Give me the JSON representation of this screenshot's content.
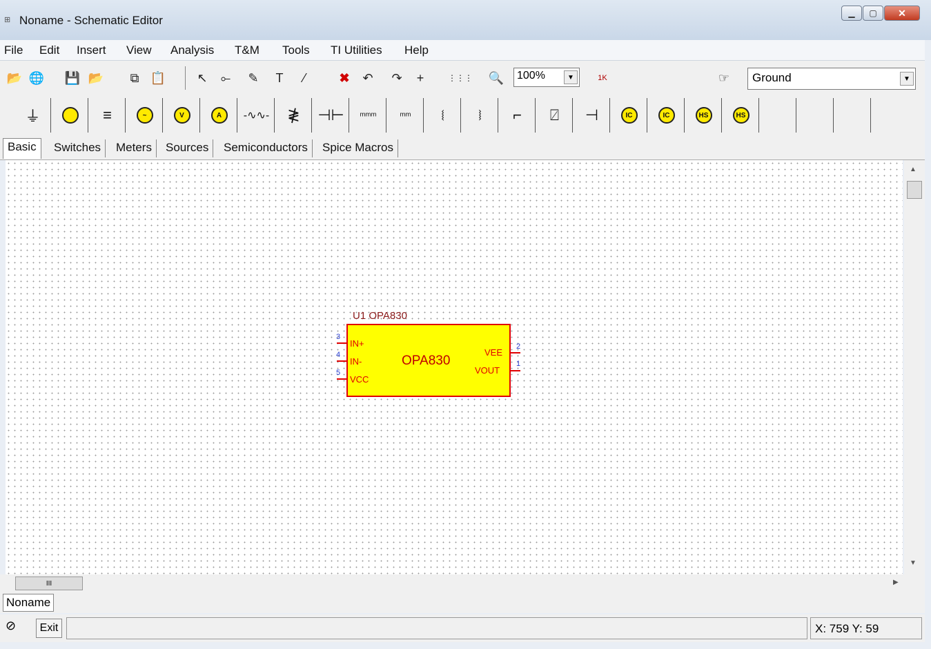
{
  "window": {
    "title": "Noname - Schematic Editor"
  },
  "menu": [
    "File",
    "Edit",
    "Insert",
    "View",
    "Analysis",
    "T&M",
    "Tools",
    "TI Utilities",
    "Help"
  ],
  "toolbar": {
    "zoom": "100%",
    "component_select": "Ground",
    "zoom_k_label": "1K"
  },
  "tabs": [
    "Basic",
    "Switches",
    "Meters",
    "Sources",
    "Semiconductors",
    "Spice Macros"
  ],
  "component": {
    "ref_label": "U1 OPA830",
    "center_label": "OPA830",
    "pins_left": [
      {
        "name": "IN+",
        "num": "3"
      },
      {
        "name": "IN-",
        "num": "4"
      },
      {
        "name": "VCC",
        "num": "5"
      }
    ],
    "pins_right": [
      {
        "name": "VEE",
        "num": "2"
      },
      {
        "name": "VOUT",
        "num": "1"
      }
    ]
  },
  "doc_tab": "Noname",
  "statusbar": {
    "exit": "Exit",
    "coords": "X: 759 Y: 59"
  },
  "colors": {
    "component_fill": "#ffff00",
    "component_border": "#e00000",
    "grid_dot": "#9a9a9a"
  }
}
